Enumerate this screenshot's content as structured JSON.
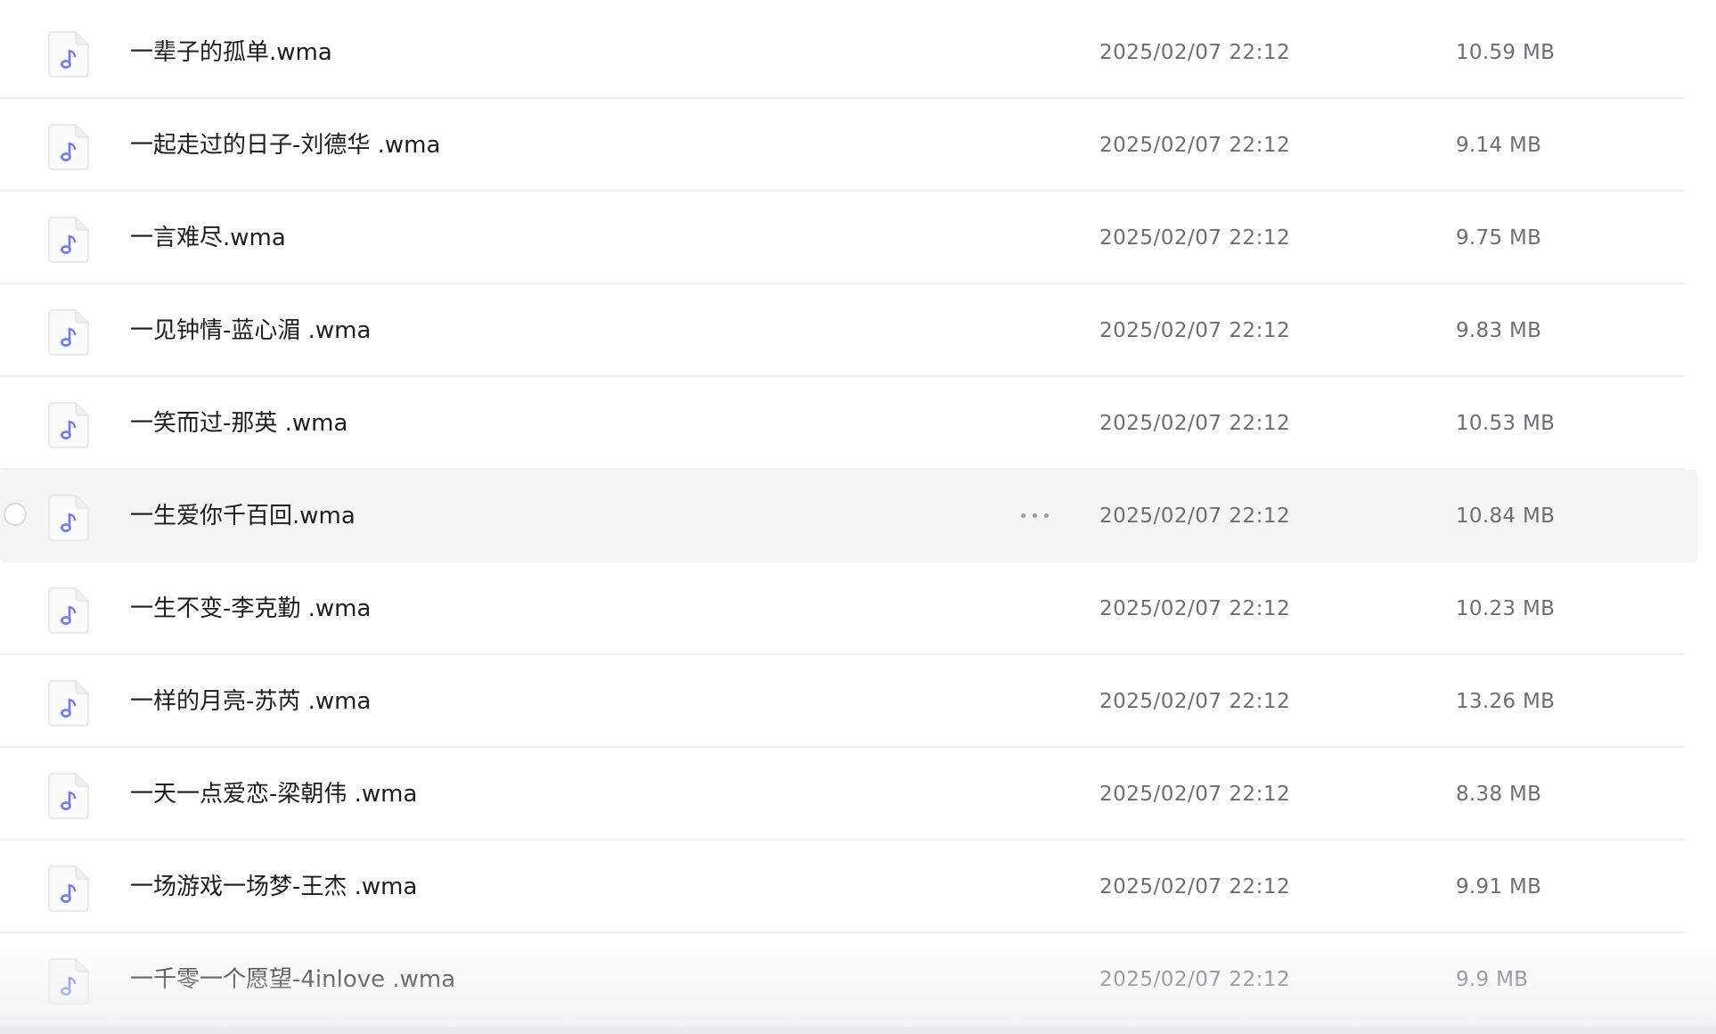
{
  "file_list": {
    "files": [
      {
        "name": "一辈子的孤单.wma",
        "modified": "2025/02/07 22:12",
        "size": "10.59 MB",
        "icon": "music-file-icon"
      },
      {
        "name": "一起走过的日子-刘德华 .wma",
        "modified": "2025/02/07 22:12",
        "size": "9.14 MB",
        "icon": "music-file-icon"
      },
      {
        "name": "一言难尽.wma",
        "modified": "2025/02/07 22:12",
        "size": "9.75 MB",
        "icon": "music-file-icon"
      },
      {
        "name": "一见钟情-蓝心湄 .wma",
        "modified": "2025/02/07 22:12",
        "size": "9.83 MB",
        "icon": "music-file-icon"
      },
      {
        "name": "一笑而过-那英 .wma",
        "modified": "2025/02/07 22:12",
        "size": "10.53 MB",
        "icon": "music-file-icon"
      },
      {
        "name": "一生爱你千百回.wma",
        "modified": "2025/02/07 22:12",
        "size": "10.84 MB",
        "icon": "music-file-icon",
        "hovered": true
      },
      {
        "name": "一生不变-李克勤 .wma",
        "modified": "2025/02/07 22:12",
        "size": "10.23 MB",
        "icon": "music-file-icon"
      },
      {
        "name": "一样的月亮-苏芮 .wma",
        "modified": "2025/02/07 22:12",
        "size": "13.26 MB",
        "icon": "music-file-icon"
      },
      {
        "name": "一天一点爱恋-梁朝伟 .wma",
        "modified": "2025/02/07 22:12",
        "size": "8.38 MB",
        "icon": "music-file-icon"
      },
      {
        "name": "一场游戏一场梦-王杰 .wma",
        "modified": "2025/02/07 22:12",
        "size": "9.91 MB",
        "icon": "music-file-icon"
      },
      {
        "name": "一千零一个愿望-4inlove .wma",
        "modified": "2025/02/07 22:12",
        "size": "9.9 MB",
        "icon": "music-file-icon"
      }
    ]
  },
  "colors": {
    "icon_note": "#6f7be6",
    "hover_row": "#f5f5f6",
    "text_primary": "#1d1d1f",
    "text_secondary": "#6e6e73"
  }
}
